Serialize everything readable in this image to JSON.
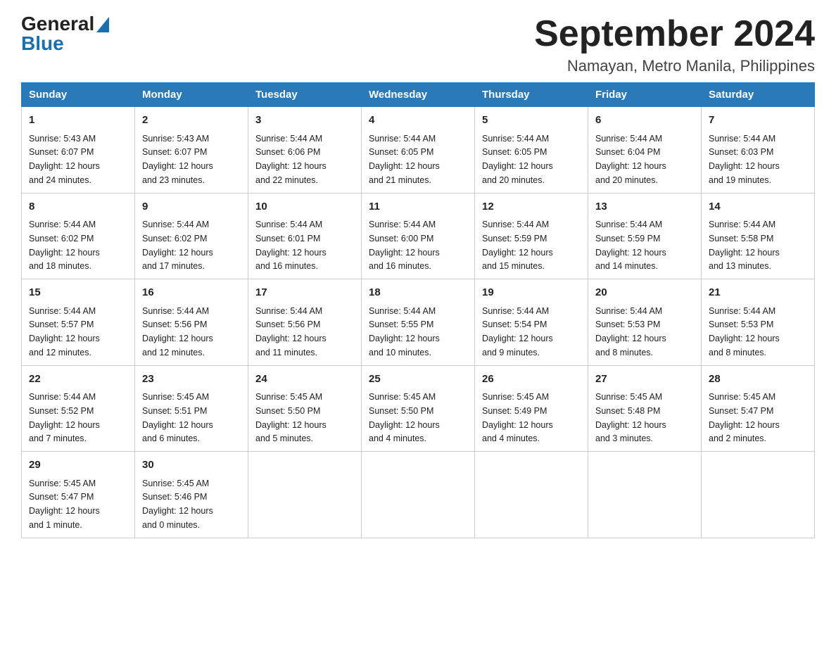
{
  "logo": {
    "general": "General",
    "blue": "Blue"
  },
  "title": "September 2024",
  "location": "Namayan, Metro Manila, Philippines",
  "days_of_week": [
    "Sunday",
    "Monday",
    "Tuesday",
    "Wednesday",
    "Thursday",
    "Friday",
    "Saturday"
  ],
  "weeks": [
    [
      {
        "day": "1",
        "sunrise": "Sunrise: 5:43 AM",
        "sunset": "Sunset: 6:07 PM",
        "daylight": "Daylight: 12 hours",
        "daylight2": "and 24 minutes."
      },
      {
        "day": "2",
        "sunrise": "Sunrise: 5:43 AM",
        "sunset": "Sunset: 6:07 PM",
        "daylight": "Daylight: 12 hours",
        "daylight2": "and 23 minutes."
      },
      {
        "day": "3",
        "sunrise": "Sunrise: 5:44 AM",
        "sunset": "Sunset: 6:06 PM",
        "daylight": "Daylight: 12 hours",
        "daylight2": "and 22 minutes."
      },
      {
        "day": "4",
        "sunrise": "Sunrise: 5:44 AM",
        "sunset": "Sunset: 6:05 PM",
        "daylight": "Daylight: 12 hours",
        "daylight2": "and 21 minutes."
      },
      {
        "day": "5",
        "sunrise": "Sunrise: 5:44 AM",
        "sunset": "Sunset: 6:05 PM",
        "daylight": "Daylight: 12 hours",
        "daylight2": "and 20 minutes."
      },
      {
        "day": "6",
        "sunrise": "Sunrise: 5:44 AM",
        "sunset": "Sunset: 6:04 PM",
        "daylight": "Daylight: 12 hours",
        "daylight2": "and 20 minutes."
      },
      {
        "day": "7",
        "sunrise": "Sunrise: 5:44 AM",
        "sunset": "Sunset: 6:03 PM",
        "daylight": "Daylight: 12 hours",
        "daylight2": "and 19 minutes."
      }
    ],
    [
      {
        "day": "8",
        "sunrise": "Sunrise: 5:44 AM",
        "sunset": "Sunset: 6:02 PM",
        "daylight": "Daylight: 12 hours",
        "daylight2": "and 18 minutes."
      },
      {
        "day": "9",
        "sunrise": "Sunrise: 5:44 AM",
        "sunset": "Sunset: 6:02 PM",
        "daylight": "Daylight: 12 hours",
        "daylight2": "and 17 minutes."
      },
      {
        "day": "10",
        "sunrise": "Sunrise: 5:44 AM",
        "sunset": "Sunset: 6:01 PM",
        "daylight": "Daylight: 12 hours",
        "daylight2": "and 16 minutes."
      },
      {
        "day": "11",
        "sunrise": "Sunrise: 5:44 AM",
        "sunset": "Sunset: 6:00 PM",
        "daylight": "Daylight: 12 hours",
        "daylight2": "and 16 minutes."
      },
      {
        "day": "12",
        "sunrise": "Sunrise: 5:44 AM",
        "sunset": "Sunset: 5:59 PM",
        "daylight": "Daylight: 12 hours",
        "daylight2": "and 15 minutes."
      },
      {
        "day": "13",
        "sunrise": "Sunrise: 5:44 AM",
        "sunset": "Sunset: 5:59 PM",
        "daylight": "Daylight: 12 hours",
        "daylight2": "and 14 minutes."
      },
      {
        "day": "14",
        "sunrise": "Sunrise: 5:44 AM",
        "sunset": "Sunset: 5:58 PM",
        "daylight": "Daylight: 12 hours",
        "daylight2": "and 13 minutes."
      }
    ],
    [
      {
        "day": "15",
        "sunrise": "Sunrise: 5:44 AM",
        "sunset": "Sunset: 5:57 PM",
        "daylight": "Daylight: 12 hours",
        "daylight2": "and 12 minutes."
      },
      {
        "day": "16",
        "sunrise": "Sunrise: 5:44 AM",
        "sunset": "Sunset: 5:56 PM",
        "daylight": "Daylight: 12 hours",
        "daylight2": "and 12 minutes."
      },
      {
        "day": "17",
        "sunrise": "Sunrise: 5:44 AM",
        "sunset": "Sunset: 5:56 PM",
        "daylight": "Daylight: 12 hours",
        "daylight2": "and 11 minutes."
      },
      {
        "day": "18",
        "sunrise": "Sunrise: 5:44 AM",
        "sunset": "Sunset: 5:55 PM",
        "daylight": "Daylight: 12 hours",
        "daylight2": "and 10 minutes."
      },
      {
        "day": "19",
        "sunrise": "Sunrise: 5:44 AM",
        "sunset": "Sunset: 5:54 PM",
        "daylight": "Daylight: 12 hours",
        "daylight2": "and 9 minutes."
      },
      {
        "day": "20",
        "sunrise": "Sunrise: 5:44 AM",
        "sunset": "Sunset: 5:53 PM",
        "daylight": "Daylight: 12 hours",
        "daylight2": "and 8 minutes."
      },
      {
        "day": "21",
        "sunrise": "Sunrise: 5:44 AM",
        "sunset": "Sunset: 5:53 PM",
        "daylight": "Daylight: 12 hours",
        "daylight2": "and 8 minutes."
      }
    ],
    [
      {
        "day": "22",
        "sunrise": "Sunrise: 5:44 AM",
        "sunset": "Sunset: 5:52 PM",
        "daylight": "Daylight: 12 hours",
        "daylight2": "and 7 minutes."
      },
      {
        "day": "23",
        "sunrise": "Sunrise: 5:45 AM",
        "sunset": "Sunset: 5:51 PM",
        "daylight": "Daylight: 12 hours",
        "daylight2": "and 6 minutes."
      },
      {
        "day": "24",
        "sunrise": "Sunrise: 5:45 AM",
        "sunset": "Sunset: 5:50 PM",
        "daylight": "Daylight: 12 hours",
        "daylight2": "and 5 minutes."
      },
      {
        "day": "25",
        "sunrise": "Sunrise: 5:45 AM",
        "sunset": "Sunset: 5:50 PM",
        "daylight": "Daylight: 12 hours",
        "daylight2": "and 4 minutes."
      },
      {
        "day": "26",
        "sunrise": "Sunrise: 5:45 AM",
        "sunset": "Sunset: 5:49 PM",
        "daylight": "Daylight: 12 hours",
        "daylight2": "and 4 minutes."
      },
      {
        "day": "27",
        "sunrise": "Sunrise: 5:45 AM",
        "sunset": "Sunset: 5:48 PM",
        "daylight": "Daylight: 12 hours",
        "daylight2": "and 3 minutes."
      },
      {
        "day": "28",
        "sunrise": "Sunrise: 5:45 AM",
        "sunset": "Sunset: 5:47 PM",
        "daylight": "Daylight: 12 hours",
        "daylight2": "and 2 minutes."
      }
    ],
    [
      {
        "day": "29",
        "sunrise": "Sunrise: 5:45 AM",
        "sunset": "Sunset: 5:47 PM",
        "daylight": "Daylight: 12 hours",
        "daylight2": "and 1 minute."
      },
      {
        "day": "30",
        "sunrise": "Sunrise: 5:45 AM",
        "sunset": "Sunset: 5:46 PM",
        "daylight": "Daylight: 12 hours",
        "daylight2": "and 0 minutes."
      },
      null,
      null,
      null,
      null,
      null
    ]
  ]
}
